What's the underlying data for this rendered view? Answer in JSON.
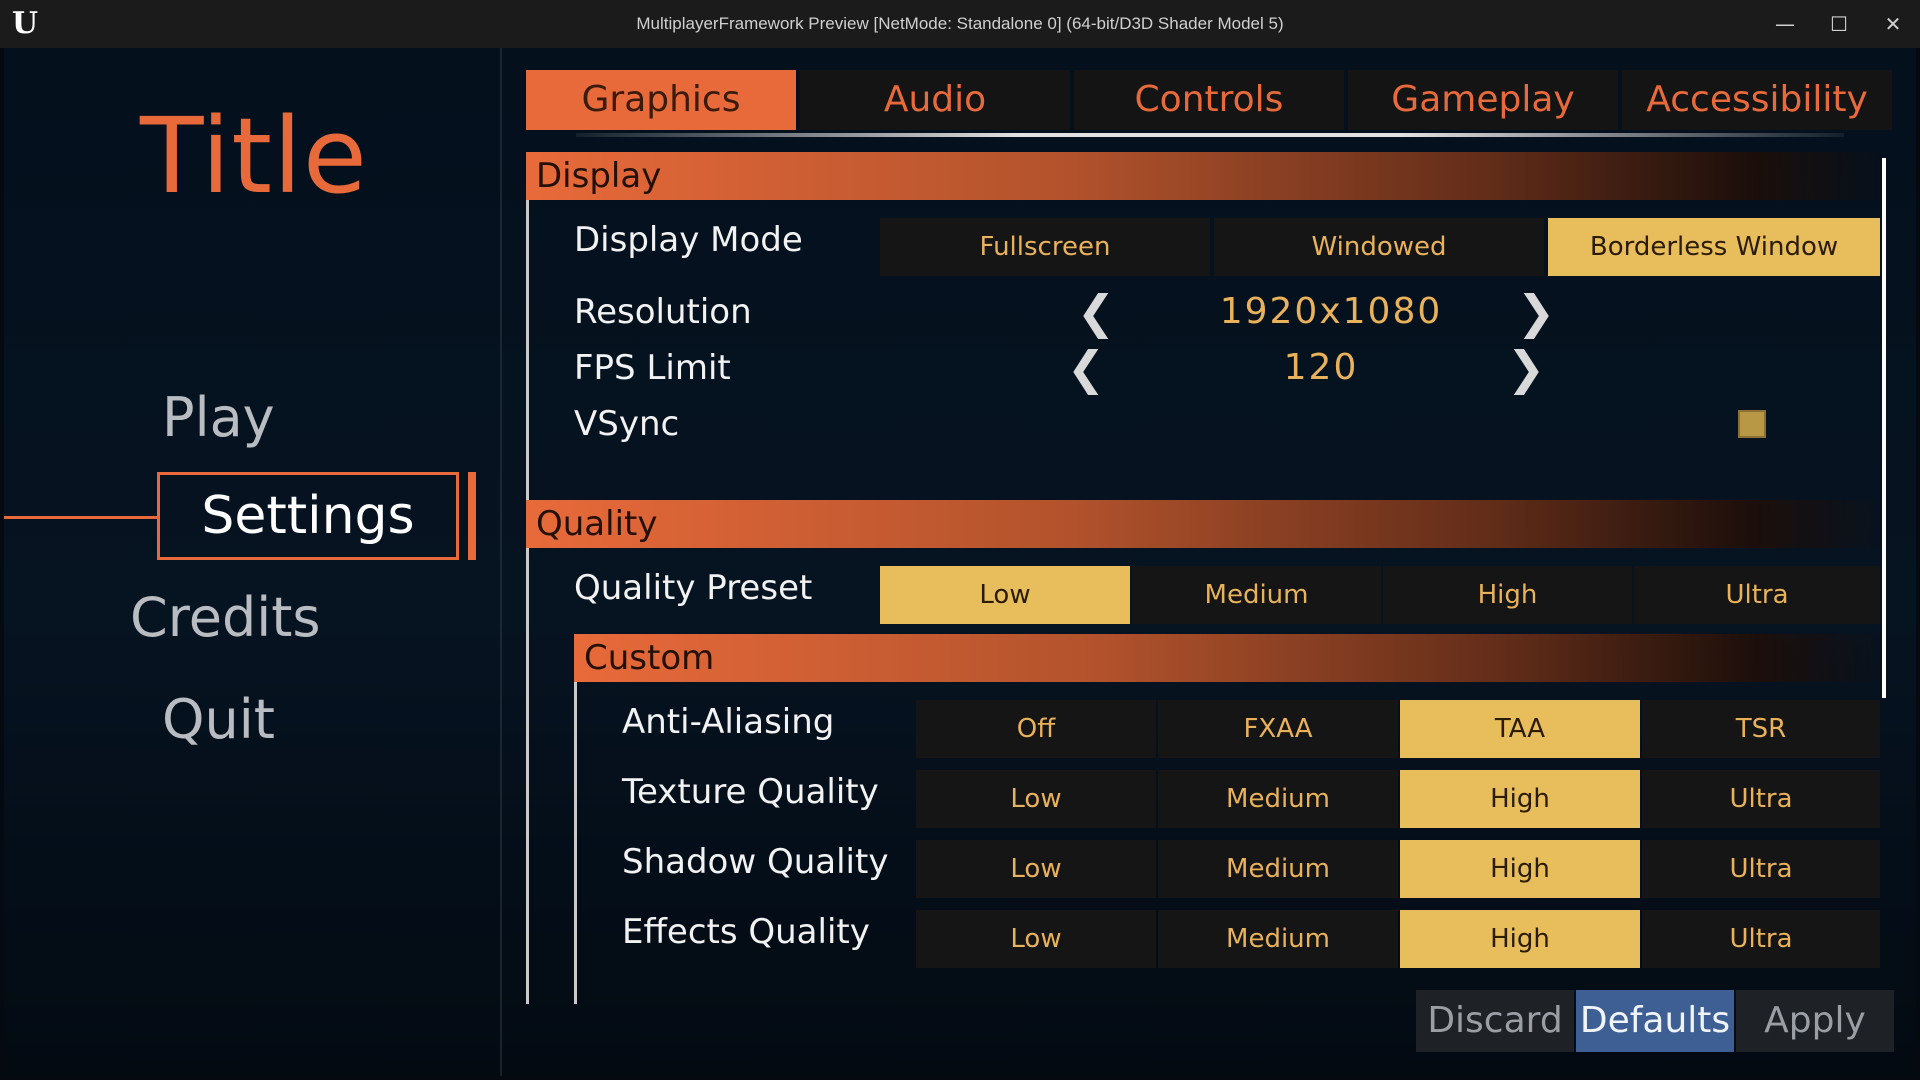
{
  "window": {
    "title": "MultiplayerFramework Preview [NetMode: Standalone 0]  (64-bit/D3D Shader Model 5)",
    "logo_glyph": "U",
    "minimize_glyph": "—",
    "maximize_glyph": "☐",
    "close_glyph": "✕"
  },
  "menu": {
    "title": "Title",
    "items": [
      {
        "label": "Play"
      },
      {
        "label": "Settings",
        "selected": true
      },
      {
        "label": "Credits"
      },
      {
        "label": "Quit"
      }
    ]
  },
  "tabs": [
    {
      "label": "Graphics",
      "active": true
    },
    {
      "label": "Audio"
    },
    {
      "label": "Controls"
    },
    {
      "label": "Gameplay"
    },
    {
      "label": "Accessibility"
    }
  ],
  "display": {
    "header": "Display",
    "display_mode": {
      "label": "Display Mode",
      "options": [
        "Fullscreen",
        "Windowed",
        "Borderless Window"
      ],
      "selected": "Borderless Window"
    },
    "resolution": {
      "label": "Resolution",
      "value": "1920x1080",
      "prev": "❮",
      "next": "❯"
    },
    "fps_limit": {
      "label": "FPS Limit",
      "value": "120",
      "prev": "❮",
      "next": "❯"
    },
    "vsync": {
      "label": "VSync",
      "checked": true
    }
  },
  "quality": {
    "header": "Quality",
    "preset": {
      "label": "Quality Preset",
      "options": [
        "Low",
        "Medium",
        "High",
        "Ultra"
      ],
      "selected": "Low"
    },
    "custom": {
      "header": "Custom",
      "anti_aliasing": {
        "label": "Anti-Aliasing",
        "options": [
          "Off",
          "FXAA",
          "TAA",
          "TSR"
        ],
        "selected": "TAA"
      },
      "texture_quality": {
        "label": "Texture Quality",
        "options": [
          "Low",
          "Medium",
          "High",
          "Ultra"
        ],
        "selected": "High"
      },
      "shadow_quality": {
        "label": "Shadow Quality",
        "options": [
          "Low",
          "Medium",
          "High",
          "Ultra"
        ],
        "selected": "High"
      },
      "effects_quality": {
        "label": "Effects Quality",
        "options": [
          "Low",
          "Medium",
          "High",
          "Ultra"
        ],
        "selected": "High"
      }
    }
  },
  "actions": {
    "discard": "Discard",
    "defaults": "Defaults",
    "apply": "Apply"
  },
  "colors": {
    "accent": "#e86a3a",
    "selected_option": "#e8bd5c",
    "option_text": "#e9b25a",
    "primary_button": "#3e5f93"
  }
}
